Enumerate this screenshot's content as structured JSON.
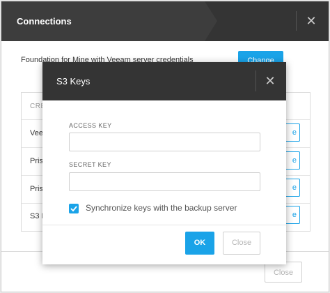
{
  "outer_dialog": {
    "title": "Connections",
    "foundation_label": "Foundation for Mine with Veeam server credentials",
    "change_label": "Change",
    "table_header": "CRE",
    "rows": [
      {
        "label": "Veea",
        "button": "e"
      },
      {
        "label": "Prisr",
        "button": "e"
      },
      {
        "label": "Prisr",
        "button": "e"
      },
      {
        "label": "S3 K",
        "button": "e"
      }
    ],
    "close_label": "Close"
  },
  "s3_dialog": {
    "title": "S3 Keys",
    "access_key_label": "ACCESS KEY",
    "access_key_value": "",
    "secret_key_label": "SECRET KEY",
    "secret_key_value": "",
    "sync_label": "Synchronize keys with the backup server",
    "sync_checked": true,
    "ok_label": "OK",
    "close_label": "Close"
  },
  "colors": {
    "accent": "#1aa3e8",
    "header_bg": "#343434"
  }
}
